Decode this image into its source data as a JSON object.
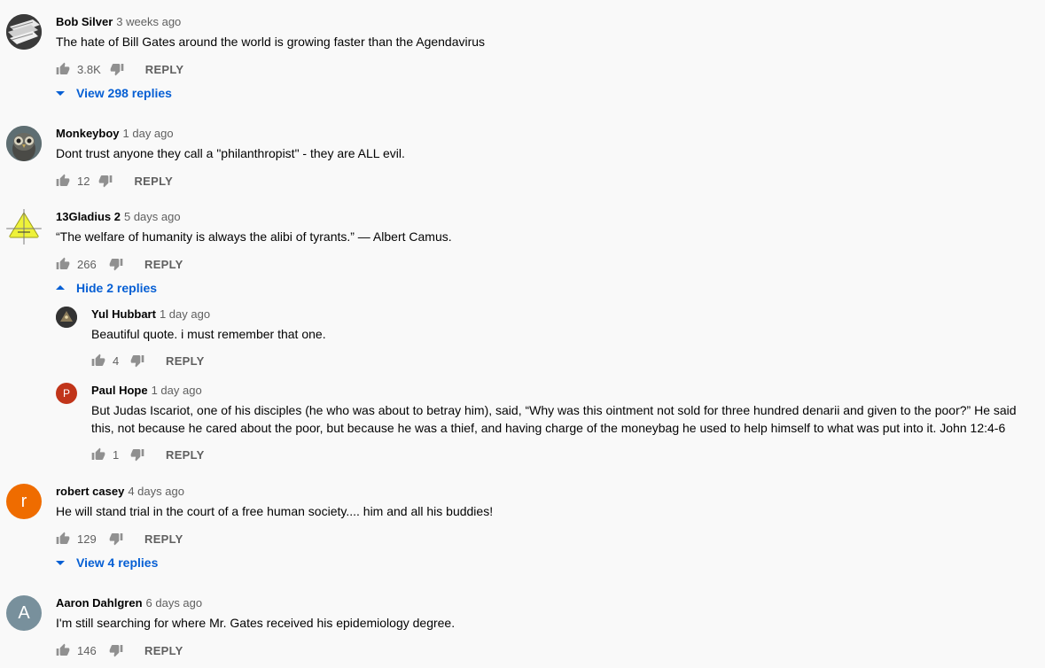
{
  "comments": [
    {
      "author": "Bob Silver",
      "time": "3 weeks ago",
      "text": "The hate of Bill Gates around the world is growing faster than the Agendavirus",
      "likes": "3.8K",
      "reply_label": "REPLY",
      "avatar_type": "image-books",
      "toggle": {
        "label": "View 298 replies",
        "direction": "down"
      }
    },
    {
      "author": "Monkeyboy",
      "time": "1 day ago",
      "text": "Dont trust anyone they call a \"philanthropist\" - they are ALL evil.",
      "likes": "12",
      "reply_label": "REPLY",
      "avatar_type": "image-owl"
    },
    {
      "author": "13Gladius 2",
      "time": "5 days ago",
      "text": "“The welfare of humanity is always the alibi of tyrants.” — Albert Camus.",
      "likes": "266",
      "reply_label": "REPLY",
      "avatar_type": "image-triangle",
      "toggle": {
        "label": "Hide 2 replies",
        "direction": "up"
      },
      "replies": [
        {
          "author": "Yul Hubbart",
          "time": "1 day ago",
          "text": "Beautiful quote. i must remember that one.",
          "likes": "4",
          "reply_label": "REPLY",
          "avatar_type": "image-pyramid"
        },
        {
          "author": "Paul Hope",
          "time": "1 day ago",
          "text": "But Judas Iscariot, one of his disciples (he who was about to betray him), said, “Why was this ointment not sold for three hundred denarii and given to the poor?” He said this, not because he cared about the poor, but because he was a thief, and having charge of the moneybag he used to help himself to what was put into it. John 12:4-6",
          "likes": "1",
          "reply_label": "REPLY",
          "avatar_letter": "P",
          "avatar_color": "#c1351a"
        }
      ]
    },
    {
      "author": "robert casey",
      "time": "4 days ago",
      "text": "He will stand trial in the court of a free human society.... him and all his buddies!",
      "likes": "129",
      "reply_label": "REPLY",
      "avatar_letter": "r",
      "avatar_color": "#ef6c00",
      "toggle": {
        "label": "View 4 replies",
        "direction": "down"
      }
    },
    {
      "author": "Aaron Dahlgren",
      "time": "6 days ago",
      "text": "I'm still searching for where Mr. Gates received his epidemiology degree.",
      "likes": "146",
      "reply_label": "REPLY",
      "avatar_letter": "A",
      "avatar_color": "#78909c"
    }
  ],
  "colors": {
    "link": "#065fd4",
    "muted": "#606060",
    "background": "#f9f9f9"
  },
  "icons": {
    "like": "thumb-up-icon",
    "dislike": "thumb-down-icon",
    "expand": "caret-down-icon",
    "collapse": "caret-up-icon"
  }
}
